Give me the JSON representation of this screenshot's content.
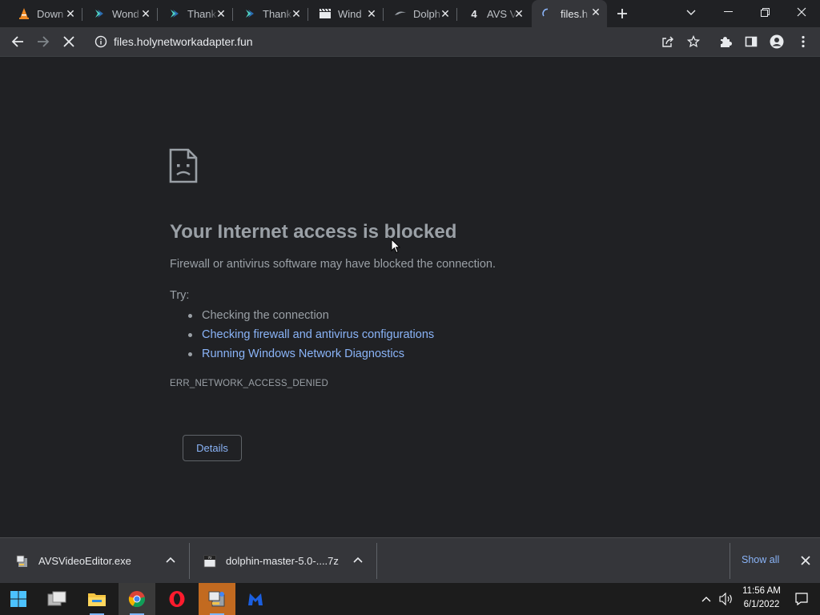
{
  "browser": {
    "tabs": [
      {
        "title": "Down",
        "icon": "vlc-cone-icon",
        "active": false
      },
      {
        "title": "Wond",
        "icon": "wondershare-icon",
        "active": false
      },
      {
        "title": "Thank",
        "icon": "wondershare-icon",
        "active": false
      },
      {
        "title": "Thank",
        "icon": "wondershare-icon",
        "active": false
      },
      {
        "title": "Wind",
        "icon": "clapperboard-icon",
        "active": false
      },
      {
        "title": "Dolph",
        "icon": "dolphin-icon",
        "active": false
      },
      {
        "title": "AVS V",
        "icon": "avs4you-icon",
        "badge": "4",
        "active": false
      },
      {
        "title": "files.h",
        "icon": "loading-spinner-icon",
        "active": true
      }
    ],
    "address_bar": {
      "url": "files.holynetworkadapter.fun"
    }
  },
  "error_page": {
    "headline": "Your Internet access is blocked",
    "description": "Firewall or antivirus software may have blocked the connection.",
    "try_label": "Try:",
    "suggestions": [
      {
        "text": "Checking the connection",
        "is_link": false
      },
      {
        "text": "Checking firewall and antivirus configurations",
        "is_link": true
      },
      {
        "text": "Running Windows Network Diagnostics",
        "is_link": true
      }
    ],
    "error_code": "ERR_NETWORK_ACCESS_DENIED",
    "details_button": "Details"
  },
  "downloads": {
    "items": [
      {
        "filename": "AVSVideoEditor.exe",
        "icon": "installer-icon"
      },
      {
        "filename": "dolphin-master-5.0-....7z",
        "icon": "7z-archive-icon"
      }
    ],
    "show_all": "Show all"
  },
  "taskbar": {
    "apps": [
      "windows-start-icon",
      "task-view-icon",
      "file-explorer-icon",
      "chrome-icon",
      "opera-icon",
      "installer-icon",
      "malwarebytes-icon"
    ],
    "time": "11:56 AM",
    "date": "6/1/2022"
  },
  "colors": {
    "page_bg": "#202124",
    "toolbar_bg": "#35363a",
    "link": "#8ab4f8",
    "text_secondary": "#9aa0a6"
  }
}
